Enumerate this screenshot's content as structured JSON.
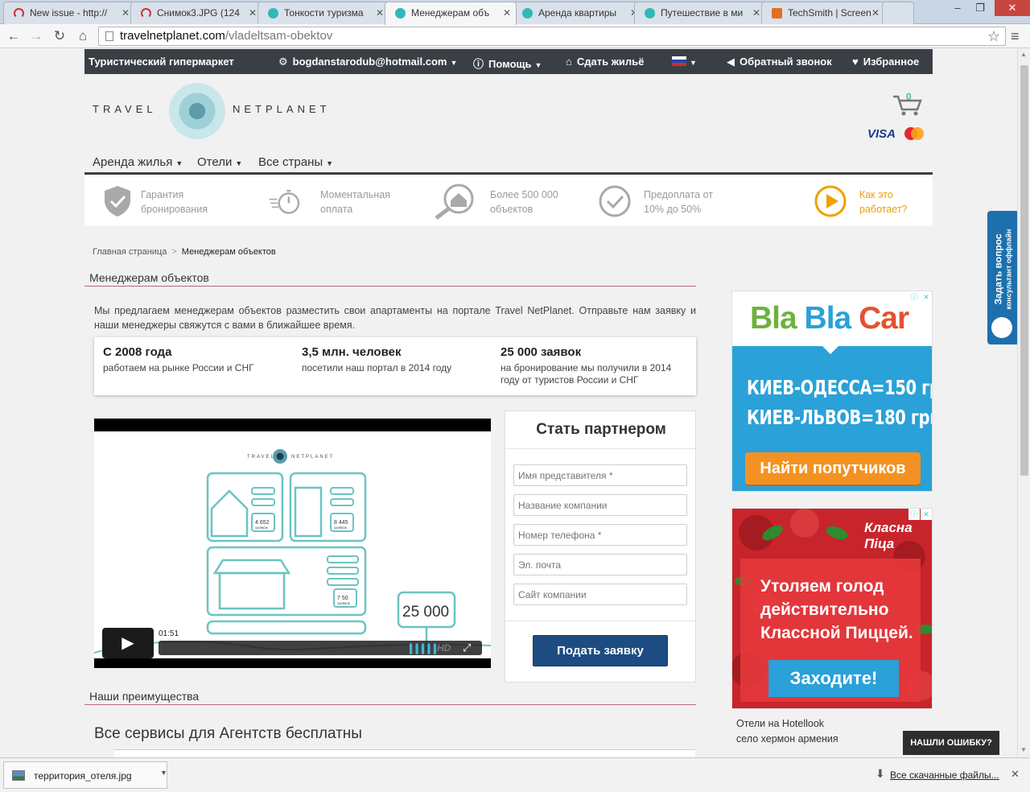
{
  "browser": {
    "tabs": [
      {
        "label": "New issue - http://",
        "icon_color": "#cc3333"
      },
      {
        "label": "Снимок3.JPG (124",
        "icon_color": "#cc3333"
      },
      {
        "label": "Тонкости туризма",
        "icon_color": "#31b8b8"
      },
      {
        "label": "Менеджерам объ",
        "icon_color": "#31b8b8"
      },
      {
        "label": "Аренда квартиры",
        "icon_color": "#31b8b8"
      },
      {
        "label": "Путешествие в ми",
        "icon_color": "#31b8b8"
      },
      {
        "label": "TechSmith | Screen",
        "icon_color": "#e07020"
      }
    ],
    "url_host": "travelnetplanet.com",
    "url_path": "/vladeltsam-obektov",
    "download_file": "территория_отеля.jpg",
    "downloads_all": "Все скачанные файлы..."
  },
  "topbar": {
    "shop": "Туристический гипермаркет",
    "account": "bogdanstarodub@hotmail.com",
    "help": "Помощь",
    "rent_out": "Сдать жильё",
    "callback": "Обратный звонок",
    "favorites": "Избранное"
  },
  "logo": {
    "left": "TRAVEL",
    "right": "NETPLANET"
  },
  "cart_count": "0",
  "payment": {
    "visa": "VISA"
  },
  "mainnav": [
    "Аренда жилья",
    "Отели",
    "Все страны"
  ],
  "features": [
    {
      "line1": "Гарантия",
      "line2": "бронирования"
    },
    {
      "line1": "Моментальная",
      "line2": "оплата"
    },
    {
      "line1": "Более 500 000",
      "line2": "объектов"
    },
    {
      "line1": "Предоплата от",
      "line2": "10% до 50%"
    },
    {
      "line1": "Как это",
      "line2": "работает?"
    }
  ],
  "breadcrumb": {
    "home": "Главная страница",
    "sep": ">",
    "current": "Менеджерам объектов"
  },
  "page_title": "Менеджерам объектов",
  "intro": "Мы предлагаем менеджерам объектов разместить свои апартаменты на портале Travel NetPlanet. Отправьте нам заявку и наши менеджеры свяжутся с вами в ближайшее время.",
  "stats": [
    {
      "head": "С 2008 года",
      "text": "работаем на рынке России и СНГ"
    },
    {
      "head": "3,5 млн. человек",
      "text": "посетили наш портал в 2014 году"
    },
    {
      "head": "25 000 заявок",
      "text": "на бронирование мы получили в 2014 году от туристов России и СНГ"
    }
  ],
  "video": {
    "time": "01:51",
    "logo_left": "TRAVEL",
    "logo_right": "NETPLANET",
    "count1": "4 652",
    "count2": "8 445",
    "count3": "7 50",
    "unit": "ЗАЯВОК",
    "big_count": "25 000",
    "hd": "HD"
  },
  "partner": {
    "title": "Стать партнером",
    "fields": [
      "Имя представителя *",
      "Название компании",
      "Номер телефона *",
      "Эл. почта",
      "Сайт компании"
    ],
    "submit": "Подать заявку"
  },
  "advantages_title": "Наши преимущества",
  "services_title": "Все сервисы для Агентств бесплатны",
  "ads": {
    "blablacar": {
      "logo_bla1": "Bla",
      "logo_bla2": "Bla",
      "logo_car": "Car",
      "line1": "КИЕВ-ОДЕССА=150 грн.",
      "line2": "КИЕВ-ЛЬВОВ=180 грн.",
      "button": "Найти попутчиков"
    },
    "pizza": {
      "logo1": "Класна",
      "logo2": "Піца",
      "text1": "Утоляем голод",
      "text2": "действительно",
      "text3": "Классной Пиццей.",
      "button": "Заходите!"
    }
  },
  "side_links": [
    "Отели на Hotellook",
    "село хермон армения"
  ],
  "consult": {
    "line1": "Задать вопрос",
    "line2": "консультант оффлайн"
  },
  "error_btn": "НАШЛИ ОШИБКУ?",
  "colors": {
    "topbar": "#3a3f45",
    "accent_orange": "#f0a000",
    "submit_blue": "#1d4c82",
    "blablacar_blue": "#2aa1d8",
    "divider_rose": "#b56a7a"
  }
}
